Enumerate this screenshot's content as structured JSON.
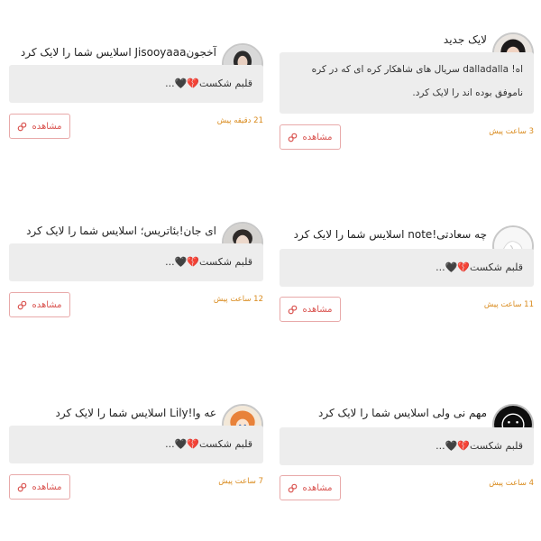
{
  "notifications": [
    {
      "title": "لایک جدید",
      "message": "اه! dalladalla سریال های شاهکار کره ای که در کره ناموفق بوده اند را لایک کرد.",
      "time": "3 ساعت پیش",
      "view_label": "مشاهده",
      "avatar": "avatar-girl-dark-hair"
    },
    {
      "title": "آخجونJisooyaaa اسلایس شما را لایک کرد",
      "message": "قلبم شکست💔🖤...",
      "time": "21 دقیقه پیش",
      "view_label": "مشاهده",
      "avatar": "avatar-girl-portrait"
    },
    {
      "title": "چه سعادتی!note اسلایس شما را لایک کرد",
      "message": "قلبم شکست💔🖤...",
      "time": "11 ساعت پیش",
      "view_label": "مشاهده",
      "avatar": "avatar-white-abstract"
    },
    {
      "title": "ای جان!بئاتریس؛ اسلایس شما را لایک کرد",
      "message": "قلبم شکست💔🖤...",
      "time": "12 ساعت پیش",
      "view_label": "مشاهده",
      "avatar": "avatar-boy-portrait"
    },
    {
      "title": "مهم نی ولی اسلایس شما را لایک کرد",
      "message": "قلبم شکست💔🖤...",
      "time": "4 ساعت پیش",
      "view_label": "مشاهده",
      "avatar": "avatar-smiley-dark"
    },
    {
      "title": "عه وا!Lily اسلایس شما را لایک کرد",
      "message": "قلبم شکست💔🖤...",
      "time": "7 ساعت پیش",
      "view_label": "مشاهده",
      "avatar": "avatar-anime-orange-hair"
    }
  ],
  "colors": {
    "time": "#d98a1c",
    "button_border": "#e8a9a9",
    "button_text": "#d9534f",
    "message_bg": "#ededed"
  },
  "icons": {
    "view_button": "link-icon"
  }
}
